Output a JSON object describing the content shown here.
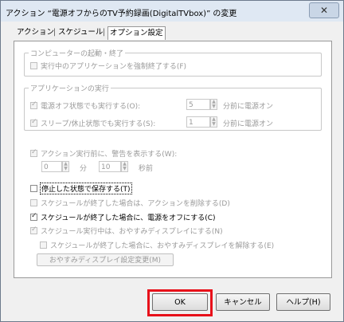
{
  "window": {
    "title": "アクション “電源オフからのTV予約録画(DigitalTVbox)” の変更",
    "close_label": "✕"
  },
  "tabs": [
    {
      "label": "アクション"
    },
    {
      "label": "スケジュール"
    },
    {
      "label": "オプション設定",
      "active": true
    }
  ],
  "computer_group": {
    "legend": "コンピューターの起動・終了",
    "force_quit_label": "実行中のアプリケーションを強制終了する(F)"
  },
  "app_group": {
    "legend": "アプリケーションの実行",
    "power_off_label": "電源オフ状態でも実行する(O):",
    "power_off_value": "5",
    "power_off_suffix": "分前に電源オン",
    "sleep_label": "スリープ/休止状態でも実行する(S):",
    "sleep_value": "1",
    "sleep_suffix": "分前に電源オン"
  },
  "warning": {
    "label": "アクション実行前に、警告を表示する(W):",
    "min_value": "0",
    "min_unit": "分",
    "sec_value": "10",
    "sec_unit": "秒前"
  },
  "options": {
    "save_stopped_label": "停止した状態で保存する(T)",
    "delete_action_label": "スケジュールが終了した場合は、アクションを削除する(D)",
    "power_off_end_label": "スケジュールが終了した場合に、電源をオフにする(C)",
    "sleep_display_label": "スケジュール実行中は、おやすみディスプレイにする(N)",
    "release_display_label": "スケジュールが終了した場合に、おやすみディスプレイを解除する(E)",
    "display_settings_button": "おやすみディスプレイ設定変更(M)"
  },
  "buttons": {
    "ok": "OK",
    "cancel": "キャンセル",
    "help": "ヘルプ(H)"
  },
  "colors": {
    "highlight": "#e8101a"
  }
}
